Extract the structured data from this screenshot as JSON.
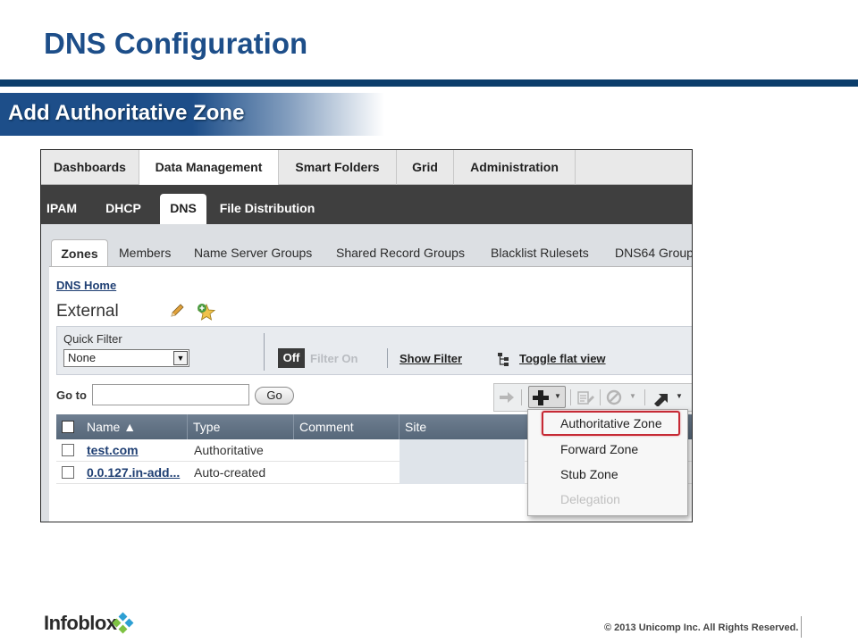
{
  "slide": {
    "title": "DNS Configuration",
    "subtitle": "Add Authoritative Zone",
    "brand": "Infoblox",
    "copyright": "© 2013 Unicomp Inc. All Rights Reserved."
  },
  "topnav": [
    "Dashboards",
    "Data Management",
    "Smart Folders",
    "Grid",
    "Administration"
  ],
  "subnav": [
    "IPAM",
    "DHCP",
    "DNS",
    "File Distribution"
  ],
  "zone_tabs": [
    "Zones",
    "Members",
    "Name Server Groups",
    "Shared Record Groups",
    "Blacklist Rulesets",
    "DNS64 Group"
  ],
  "breadcrumb": "DNS Home",
  "zone_view": "External",
  "filter": {
    "quick_filter_label": "Quick Filter",
    "quick_filter_value": "None",
    "toggle_off": "Off",
    "toggle_on": "Filter On",
    "show_filter": "Show Filter",
    "toggle_flat_view": "Toggle flat view"
  },
  "goto": {
    "label": "Go to",
    "button": "Go"
  },
  "grid": {
    "columns": [
      "Name ▲",
      "Type",
      "Comment",
      "Site"
    ],
    "rows": [
      {
        "name": "test.com",
        "type": "Authoritative"
      },
      {
        "name": "0.0.127.in-add...",
        "type": "Auto-created"
      }
    ]
  },
  "add_menu": {
    "items": [
      "Authoritative Zone",
      "Forward Zone",
      "Stub Zone",
      "Delegation"
    ],
    "highlighted": "Authoritative Zone",
    "disabled": [
      "Delegation"
    ]
  },
  "colors": {
    "title": "#1d4e89",
    "band": "#0b3d6b",
    "highlight": "#c62a35"
  }
}
